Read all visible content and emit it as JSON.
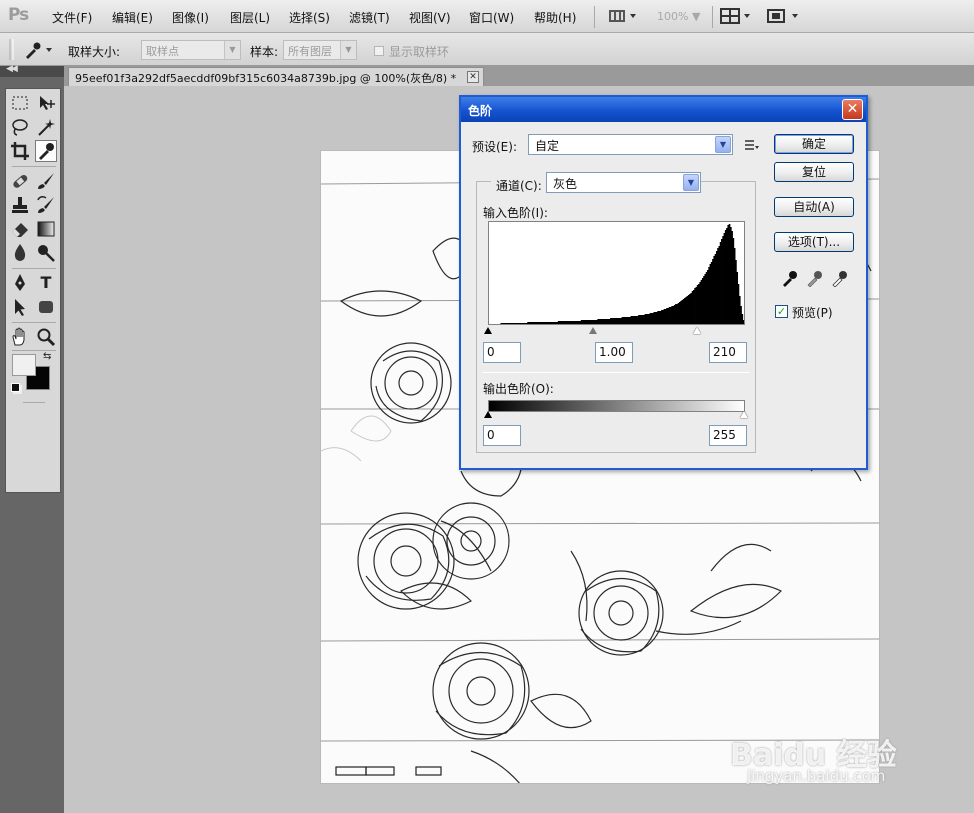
{
  "app": {
    "logo": "Ps"
  },
  "menubar": {
    "items": [
      "文件(F)",
      "编辑(E)",
      "图像(I)",
      "图层(L)",
      "选择(S)",
      "滤镜(T)",
      "视图(V)",
      "窗口(W)",
      "帮助(H)"
    ],
    "zoom": "100%"
  },
  "options": {
    "sample_size_label": "取样大小:",
    "sample_size_value": "取样点",
    "sample_label": "样本:",
    "sample_value": "所有图层",
    "show_ring_label": "显示取样环"
  },
  "document": {
    "tab_title": "95eef01f3a292df5aecddf09bf315c6034a8739b.jpg @ 100%(灰色/8) *"
  },
  "levels_dialog": {
    "title": "色阶",
    "preset_label": "预设(E):",
    "preset_value": "自定",
    "channel_label": "通道(C):",
    "channel_value": "灰色",
    "input_levels_label": "输入色阶(I):",
    "input_black": "0",
    "input_gamma": "1.00",
    "input_white": "210",
    "output_levels_label": "输出色阶(O):",
    "output_black": "0",
    "output_white": "255",
    "buttons": {
      "ok": "确定",
      "reset": "复位",
      "auto": "自动(A)",
      "options": "选项(T)..."
    },
    "preview_label": "预览(P)",
    "preview_checked": true,
    "histogram": [
      0,
      0,
      0,
      0,
      0,
      0,
      0,
      0,
      0,
      1,
      1,
      1,
      1,
      1,
      1,
      1,
      1,
      1,
      1,
      1,
      1,
      1,
      1,
      1,
      1,
      1,
      1,
      1,
      1,
      1,
      2,
      2,
      2,
      2,
      2,
      2,
      2,
      2,
      2,
      2,
      2,
      2,
      2,
      2,
      2,
      2,
      2,
      2,
      2,
      2,
      2,
      2,
      2,
      2,
      3,
      3,
      3,
      3,
      3,
      3,
      3,
      3,
      3,
      3,
      3,
      3,
      3,
      3,
      3,
      3,
      3,
      3,
      4,
      4,
      4,
      4,
      4,
      4,
      4,
      4,
      4,
      4,
      4,
      4,
      4,
      5,
      5,
      5,
      5,
      5,
      5,
      5,
      5,
      5,
      5,
      6,
      6,
      6,
      6,
      6,
      6,
      6,
      6,
      6,
      7,
      7,
      7,
      7,
      7,
      7,
      7,
      8,
      8,
      8,
      8,
      8,
      8,
      9,
      9,
      9,
      9,
      9,
      10,
      10,
      10,
      10,
      11,
      11,
      11,
      12,
      12,
      12,
      13,
      13,
      13,
      14,
      14,
      15,
      15,
      16,
      16,
      17,
      17,
      18,
      18,
      19,
      20,
      20,
      21,
      22,
      23,
      24,
      25,
      26,
      27,
      28,
      29,
      30,
      31,
      33,
      34,
      36,
      37,
      39,
      40,
      42,
      44,
      46,
      48,
      50,
      52,
      54,
      57,
      60,
      62,
      65,
      68,
      70,
      73,
      76,
      78,
      82,
      85,
      88,
      91,
      94,
      96,
      99,
      100,
      97,
      93,
      86,
      76,
      64,
      52,
      40,
      28,
      18,
      10,
      4
    ]
  },
  "watermark": {
    "main": "Baidu 经验",
    "sub": "jingyan.baidu.com"
  }
}
